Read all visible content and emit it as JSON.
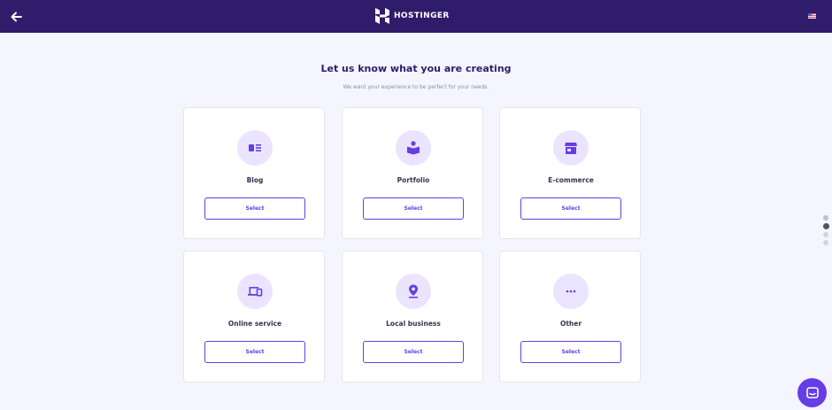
{
  "header": {
    "brand": "HOSTINGER",
    "back_icon": "arrow-left-icon",
    "logo_icon": "hostinger-logo-icon",
    "flag_icon": "us-flag-icon"
  },
  "main": {
    "heading": "Let us know what you are creating",
    "subheading": "We want your experience to be perfect for your needs."
  },
  "options": [
    {
      "label": "Blog",
      "icon": "blog-icon",
      "button": "Select"
    },
    {
      "label": "Portfolio",
      "icon": "portfolio-icon",
      "button": "Select"
    },
    {
      "label": "E-commerce",
      "icon": "store-icon",
      "button": "Select"
    },
    {
      "label": "Online service",
      "icon": "devices-icon",
      "button": "Select"
    },
    {
      "label": "Local business",
      "icon": "location-pin-icon",
      "button": "Select"
    },
    {
      "label": "Other",
      "icon": "more-dots-icon",
      "button": "Select"
    }
  ],
  "progress": {
    "steps": 4,
    "current_step": 2
  },
  "chat": {
    "icon": "chat-icon"
  },
  "colors": {
    "header_bg": "#2f1c6a",
    "accent": "#673de6",
    "icon_bg": "#ebe4ff",
    "page_bg": "#f4f5ff"
  }
}
